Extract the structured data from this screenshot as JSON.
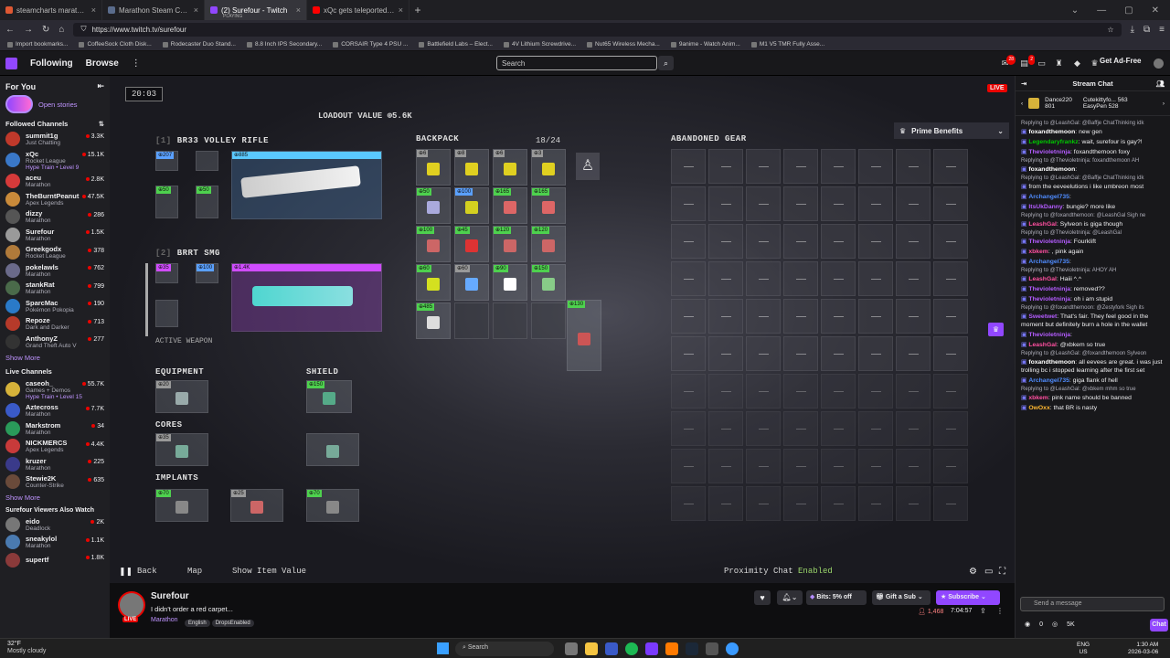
{
  "browser": {
    "tabs": [
      {
        "title": "steamcharts marathon at DuckD",
        "color": "#de5833"
      },
      {
        "title": "Marathon Steam Charts - Steam",
        "color": "#5a6c8c"
      },
      {
        "title": "(2) Surefour - Twitch",
        "subtitle": "PLAYING",
        "color": "#9147ff"
      },
      {
        "title": "xQc gets teleported to a Rando",
        "color": "#ff0000"
      }
    ],
    "url": "https://www.twitch.tv/surefour",
    "bookmarks": [
      "Import bookmarks...",
      "CoffeeSock Cloth Disk...",
      "Rodecaster Duo Stand...",
      "8.8 Inch IPS Secondary...",
      "CORSAIR Type 4 PSU ...",
      "Battlefield Labs – Elect...",
      "4V Lithium Screwdrive...",
      "Nut65 Wireless Mecha...",
      "9anime - Watch Anim...",
      "M1 V5 TMR Fully Asse..."
    ]
  },
  "twitch": {
    "nav": {
      "following": "Following",
      "browse": "Browse",
      "search_placeholder": "Search",
      "ad_free": "Get Ad-Free",
      "notif_count_1": "28",
      "notif_count_2": "2"
    },
    "sidebar": {
      "for_you": "For You",
      "open_stories": "Open stories",
      "followed_header": "Followed Channels",
      "followed": [
        {
          "name": "summit1g",
          "game": "Just Chatting",
          "viewers": "3.3K",
          "color": "#c0392b"
        },
        {
          "name": "xQc",
          "game": "Rocket League",
          "extra": "Hype Train • Level 9",
          "viewers": "15.1K",
          "color": "#3a78c8"
        },
        {
          "name": "aceu",
          "game": "Marathon",
          "viewers": "2.8K",
          "color": "#d63a3a"
        },
        {
          "name": "TheBurntPeanut",
          "game": "Apex Legends",
          "viewers": "47.5K",
          "color": "#c98a3a"
        },
        {
          "name": "dizzy",
          "game": "Marathon",
          "viewers": "286",
          "color": "#555"
        },
        {
          "name": "Surefour",
          "game": "Marathon",
          "viewers": "1.5K",
          "color": "#9a9a9a"
        },
        {
          "name": "Greekgodx",
          "game": "Rocket League",
          "viewers": "378",
          "color": "#b07a3a"
        },
        {
          "name": "pokelawls",
          "game": "Marathon",
          "viewers": "762",
          "color": "#6a6a8a"
        },
        {
          "name": "stankRat",
          "game": "Marathon",
          "viewers": "799",
          "color": "#4a6a4a"
        },
        {
          "name": "SparcMac",
          "game": "Pokémon Pokopia",
          "viewers": "190",
          "color": "#2a7ac8"
        },
        {
          "name": "Repoze",
          "game": "Dark and Darker",
          "viewers": "713",
          "color": "#b63a2a"
        },
        {
          "name": "AnthonyZ",
          "game": "Grand Theft Auto V",
          "viewers": "277",
          "color": "#333"
        }
      ],
      "show_more_1": "Show More",
      "live_header": "Live Channels",
      "live": [
        {
          "name": "caseoh_",
          "game": "Games + Demos",
          "extra": "Hype Train • Level 15",
          "viewers": "55.7K",
          "color": "#d6b23a"
        },
        {
          "name": "Aztecross",
          "game": "Marathon",
          "viewers": "7.7K",
          "color": "#3a5ac8"
        },
        {
          "name": "Markstrom",
          "game": "Marathon",
          "viewers": "34",
          "color": "#2a9a5a"
        },
        {
          "name": "NICKMERCS",
          "game": "Apex Legends",
          "viewers": "4.4K",
          "color": "#c83a3a"
        },
        {
          "name": "kruzer",
          "game": "Marathon",
          "viewers": "225",
          "color": "#3a3a8a"
        },
        {
          "name": "Stewie2K",
          "game": "Counter-Strike",
          "viewers": "635",
          "color": "#6a4a3a"
        }
      ],
      "show_more_2": "Show More",
      "also_header": "Surefour Viewers Also Watch",
      "also": [
        {
          "name": "eido",
          "game": "Deadlock",
          "viewers": "2K",
          "color": "#777"
        },
        {
          "name": "sneakylol",
          "game": "Marathon",
          "viewers": "1.1K",
          "color": "#4a7ab0"
        },
        {
          "name": "supertf",
          "game": "",
          "viewers": "1.8K",
          "color": "#8a3a3a"
        }
      ]
    },
    "game": {
      "timer": "20:03",
      "loadout_value": "LOADOUT VALUE ⊕5.6K",
      "weapon1": {
        "slot": "[1]",
        "name": "BR33 VOLLEY RIFLE",
        "price": "⊕885"
      },
      "weapon2": {
        "slot": "[2]",
        "name": "BRRT SMG",
        "price": "⊕1.4K"
      },
      "active_weapon": "ACTIVE WEAPON",
      "backpack": "BACKPACK",
      "backpack_count": "18/24",
      "abandoned": "ABANDONED GEAR",
      "prime": "Prime Benefits",
      "equipment": "EQUIPMENT",
      "shield": "SHIELD",
      "cores": "CORES",
      "implants": "IMPLANTS",
      "live_badge": "LIVE",
      "bottom": {
        "back": "Back",
        "map": "Map",
        "show_item": "Show Item Value",
        "proximity": "Proximity Chat",
        "enabled": "Enabled"
      },
      "mod_prices": [
        "⊕207",
        "⊕20",
        "⊕50",
        "⊕50"
      ],
      "smg_prices": [
        "⊕35",
        "⊕100"
      ],
      "equip_price": "⊕20",
      "shield_price": "⊕150",
      "core_price": "⊕35",
      "implant_prices": [
        "⊕70",
        "⊕25",
        "⊕70"
      ],
      "bp_prices": [
        "⊕6",
        "⊕8",
        "⊕6",
        "⊕3",
        "⊕50",
        "⊕100",
        "⊕165",
        "⊕165",
        "⊕100",
        "⊕45",
        "⊕120",
        "⊕120",
        "⊕60",
        "⊕60",
        "⊕90",
        "⊕150",
        "⊕485",
        "⊕130"
      ]
    },
    "channel": {
      "name": "Surefour",
      "title": "I didn't order a red carpet...",
      "category": "Marathon",
      "tags": [
        "English",
        "DropsEnabled"
      ],
      "viewers": "1,468",
      "uptime": "7:04:57",
      "bits_offer": "Bits: 5% off",
      "gift": "Gift a Sub",
      "subscribe": "Subscribe",
      "live": "LIVE"
    },
    "chat": {
      "header": "Stream Chat",
      "pinned": [
        {
          "name": "Dance220",
          "value": "801"
        },
        {
          "name": "Cutekittyfo...",
          "value": "563"
        },
        {
          "name": "EasyPen",
          "value": "528"
        }
      ],
      "messages": [
        {
          "reply": "Replying to @LeashGal: @Baffje ChatThinking idk",
          "user": "foxandthemoon",
          "color": "#ffffff",
          "text": "new gen"
        },
        {
          "user": "Legendaryfrankz",
          "color": "#00c800",
          "text": "wait, surefour is gay?!"
        },
        {
          "user": "Thevioletninja",
          "color": "#b45cff",
          "text": "foxandthemoon foxy"
        },
        {
          "reply": "Replying to @Thevioletninja: foxandthemoon AH",
          "user": "foxandthemoon",
          "color": "#ffffff",
          "text": ""
        },
        {
          "reply": "Replying to @LeashGal: @Baffje ChatThinking idk",
          "user": "",
          "color": "#5a5aff",
          "text": "from the eeveelutions i like umbreon most"
        },
        {
          "user": "Archangel735",
          "color": "#4f8cff",
          "text": ""
        },
        {
          "user": "ItsUkDanny",
          "color": "#b45cff",
          "text": "bungie? more like"
        },
        {
          "reply": "Replying to @foxandthemoon: @LeashGal Sigh ne",
          "user": "LeashGal",
          "color": "#ff4fa0",
          "text": "Sylveon is giga though"
        },
        {
          "reply": "Replying to @Thevioletninja: @LeashGal",
          "user": "Thevioletninja",
          "color": "#b45cff",
          "text": "Fourklift"
        },
        {
          "user": "xbkem",
          "color": "#ff4fa0",
          "text": ", pink again"
        },
        {
          "user": "Archangel735",
          "color": "#4f8cff",
          "text": ""
        },
        {
          "reply": "Replying to @Thevioletninja: AHOY AH",
          "user": "LeashGal",
          "color": "#ff4fa0",
          "text": "Haiii ^.^"
        },
        {
          "user": "Thevioletninja",
          "color": "#b45cff",
          "text": "removed??"
        },
        {
          "user": "Thevioletninja",
          "color": "#b45cff",
          "text": "oh i am stupid"
        },
        {
          "reply": "Replying to @foxandthemoon: @Zestyfork Sigh its",
          "user": "Sweetwet",
          "color": "#b45cff",
          "text": "That's fair. They feel good in the moment but definitely burn a hole in the wallet"
        },
        {
          "user": "Thevioletninja",
          "color": "#b45cff",
          "text": ""
        },
        {
          "user": "LeashGal",
          "color": "#ff4fa0",
          "text": "@xbkem so true"
        },
        {
          "reply": "Replying to @LeashGal: @foxandthemoon Sylveon",
          "user": "foxandthemoon",
          "color": "#ffffff",
          "text": "all eevees are great. i was just trolling bc i stopped learning after the first set"
        },
        {
          "user": "Archangel735",
          "color": "#4f8cff",
          "text": "giga flank of hell"
        },
        {
          "reply": "Replying to @LeashGal: @xbkem mhm so true",
          "user": "xbkem",
          "color": "#ff4fa0",
          "text": "pink name should be banned"
        },
        {
          "user": "OwOxx",
          "color": "#ffb830",
          "text": "that BR is nasty"
        }
      ],
      "input_placeholder": "Send a message",
      "points": "0",
      "points2": "5K",
      "chat_button": "Chat"
    }
  },
  "taskbar": {
    "weather_temp": "32°F",
    "weather_desc": "Mostly cloudy",
    "search": "Search",
    "lang1": "ENG",
    "lang2": "US",
    "time": "1:30 AM",
    "date": "2026-03-06"
  }
}
